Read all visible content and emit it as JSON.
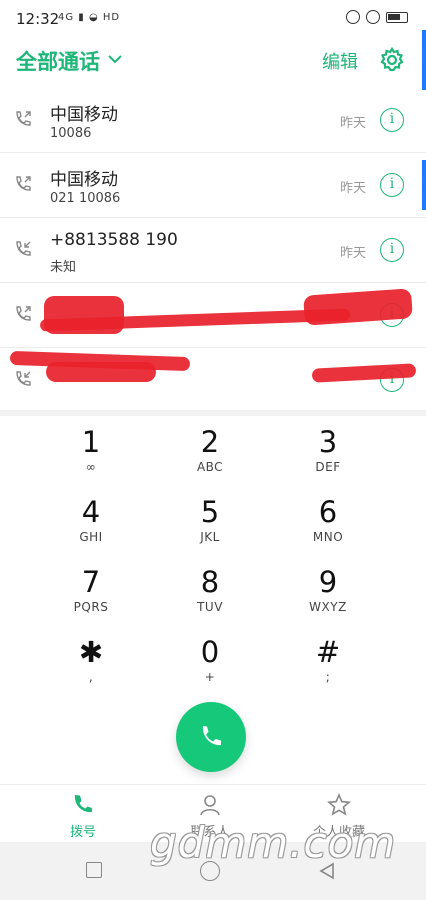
{
  "status_bar": {
    "time": "12:32",
    "signal": "4G ▮ ◒ HD"
  },
  "header": {
    "title": "全部通话",
    "edit_label": "编辑"
  },
  "calls": [
    {
      "name": "中国移动",
      "number": "10086",
      "when": "昨天"
    },
    {
      "name": "中国移动",
      "number": "021 10086",
      "when": "昨天"
    },
    {
      "name": "+8813588  190",
      "number": "未知",
      "when": "昨天"
    },
    {
      "name": "",
      "number": "",
      "when": ""
    },
    {
      "name": "",
      "number": "",
      "when": ""
    }
  ],
  "keypad": [
    {
      "digit": "1",
      "letters": "∞"
    },
    {
      "digit": "2",
      "letters": "ABC"
    },
    {
      "digit": "3",
      "letters": "DEF"
    },
    {
      "digit": "4",
      "letters": "GHI"
    },
    {
      "digit": "5",
      "letters": "JKL"
    },
    {
      "digit": "6",
      "letters": "MNO"
    },
    {
      "digit": "7",
      "letters": "PQRS"
    },
    {
      "digit": "8",
      "letters": "TUV"
    },
    {
      "digit": "9",
      "letters": "WXYZ"
    },
    {
      "digit": "✱",
      "letters": ","
    },
    {
      "digit": "0",
      "letters": "+"
    },
    {
      "digit": "#",
      "letters": ";"
    }
  ],
  "tabs": [
    {
      "label": "拨号",
      "icon": "phone-icon",
      "active": true
    },
    {
      "label": "联系人",
      "icon": "person-icon",
      "active": false
    },
    {
      "label": "个人收藏",
      "icon": "star-icon",
      "active": false
    }
  ],
  "watermark": "gdmm.com",
  "colors": {
    "accent": "#1fb67a",
    "dial_button": "#16c97a",
    "redaction": "#e8212b"
  }
}
